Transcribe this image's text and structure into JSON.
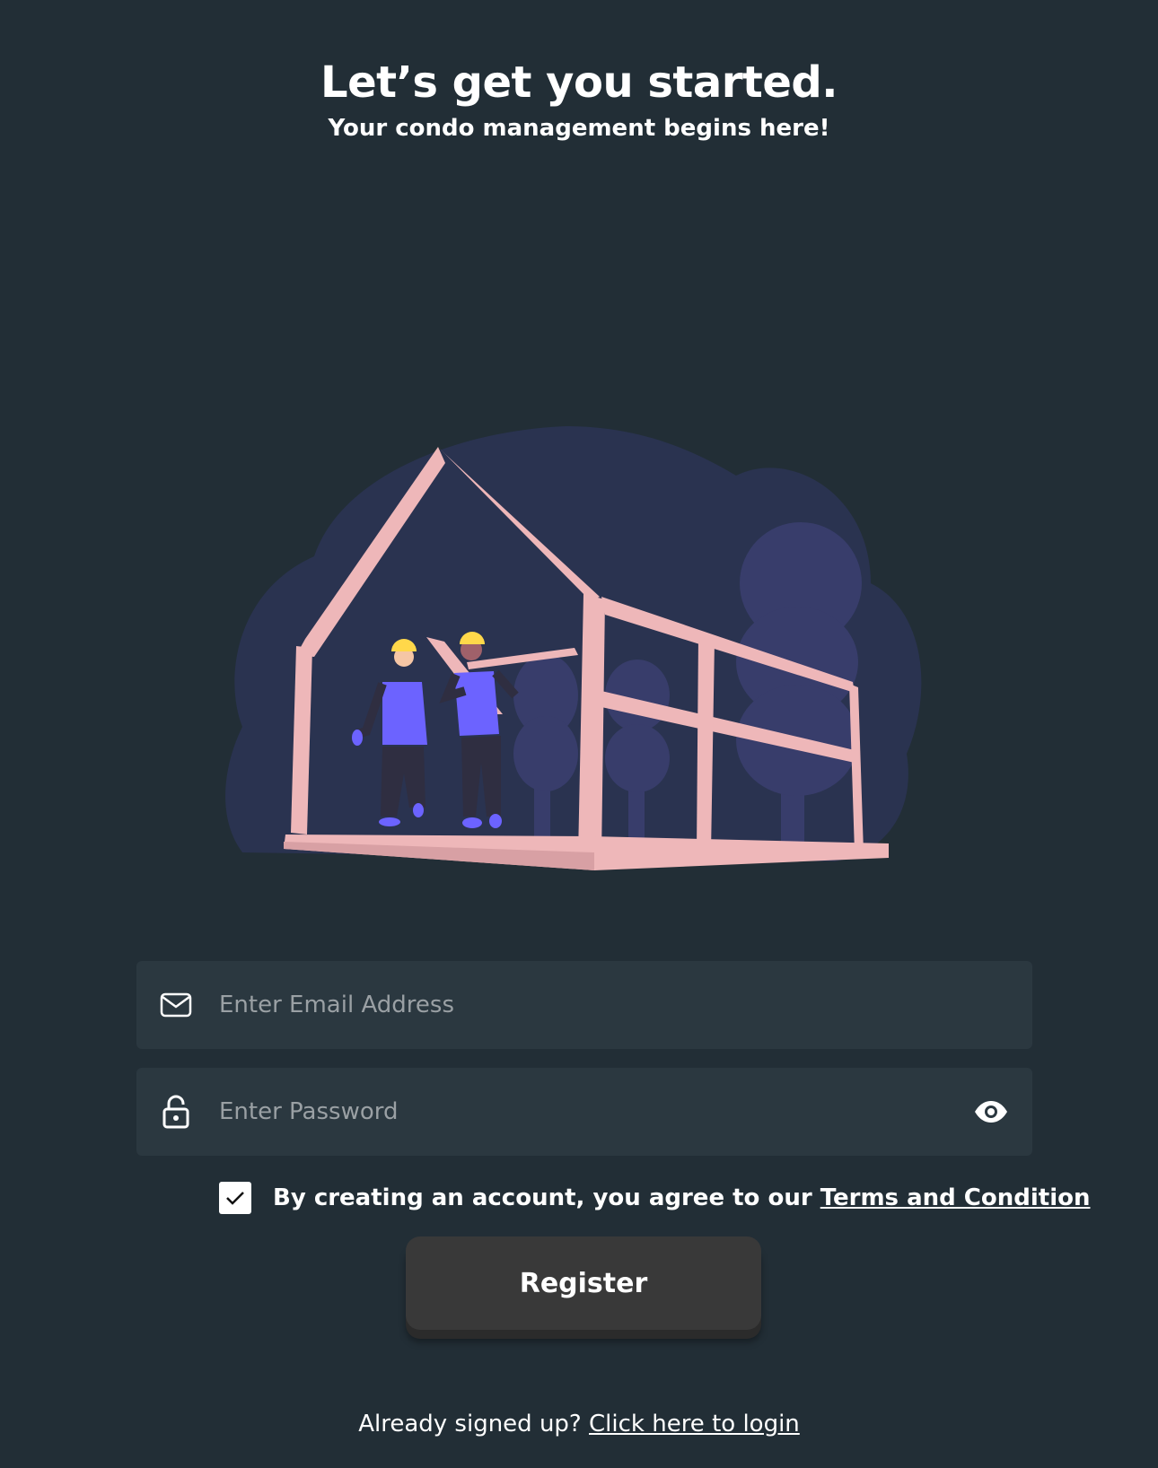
{
  "header": {
    "title": "Let’s get you started.",
    "subtitle": "Your condo management begins here!"
  },
  "form": {
    "email": {
      "placeholder": "Enter Email Address",
      "value": "",
      "icon": "mail-icon"
    },
    "password": {
      "placeholder": "Enter Password",
      "value": "",
      "icon": "lock-icon",
      "toggle_icon": "eye-icon"
    },
    "agreement": {
      "checked": true,
      "text": "By creating an account, you agree to our ",
      "link_text": "Terms and Condition"
    },
    "register_label": "Register"
  },
  "footer": {
    "text": "Already signed up? ",
    "link_text": "Click here to login"
  },
  "colors": {
    "background": "#222e36",
    "field_background": "#2b3840",
    "button_background": "#393939",
    "illustration_blob": "#2a3350",
    "frame": "#eeb7b9",
    "worker_vest": "#6c63ff"
  }
}
